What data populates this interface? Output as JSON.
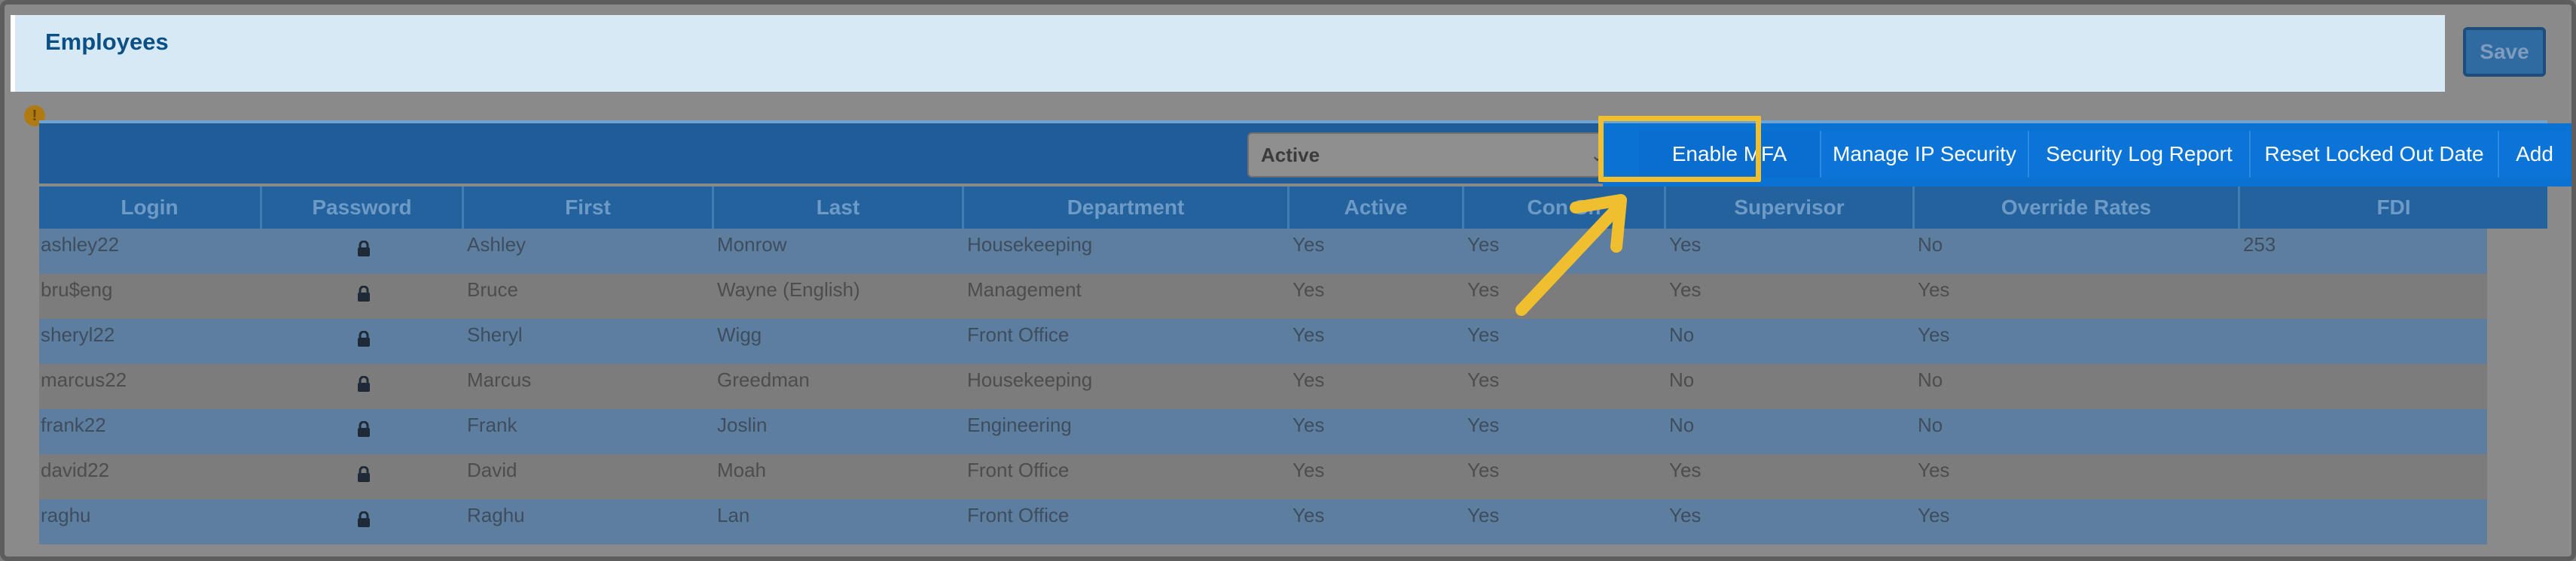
{
  "header": {
    "title": "Employees"
  },
  "actions": {
    "save_label": "Save"
  },
  "toolbar": {
    "status_filter": {
      "selected": "Active"
    },
    "buttons": [
      {
        "label": "Enable MFA"
      },
      {
        "label": "Manage IP Security"
      },
      {
        "label": "Security Log Report"
      },
      {
        "label": "Reset Locked Out Date"
      },
      {
        "label": "Add"
      }
    ]
  },
  "table": {
    "columns": [
      "Login",
      "Password",
      "First",
      "Last",
      "Department",
      "Active",
      "Con Sh",
      "Supervisor",
      "Override Rates",
      "FDI"
    ],
    "rows": [
      {
        "login": "ashley22",
        "first": "Ashley",
        "last": "Monrow",
        "department": "Housekeeping",
        "active": "Yes",
        "con": "Yes",
        "supervisor": "Yes",
        "override": "No",
        "fdi": "253"
      },
      {
        "login": "bru$eng",
        "first": "Bruce",
        "last": "Wayne (English)",
        "department": "Management",
        "active": "Yes",
        "con": "Yes",
        "supervisor": "Yes",
        "override": "Yes",
        "fdi": ""
      },
      {
        "login": "sheryl22",
        "first": "Sheryl",
        "last": "Wigg",
        "department": "Front Office",
        "active": "Yes",
        "con": "Yes",
        "supervisor": "No",
        "override": "Yes",
        "fdi": ""
      },
      {
        "login": "marcus22",
        "first": "Marcus",
        "last": "Greedman",
        "department": "Housekeeping",
        "active": "Yes",
        "con": "Yes",
        "supervisor": "No",
        "override": "No",
        "fdi": ""
      },
      {
        "login": "frank22",
        "first": "Frank",
        "last": "Joslin",
        "department": "Engineering",
        "active": "Yes",
        "con": "Yes",
        "supervisor": "No",
        "override": "No",
        "fdi": ""
      },
      {
        "login": "david22",
        "first": "David",
        "last": "Moah",
        "department": "Front Office",
        "active": "Yes",
        "con": "Yes",
        "supervisor": "Yes",
        "override": "Yes",
        "fdi": ""
      },
      {
        "login": "raghu",
        "first": "Raghu",
        "last": "Lan",
        "department": "Front Office",
        "active": "Yes",
        "con": "Yes",
        "supervisor": "Yes",
        "override": "Yes",
        "fdi": ""
      }
    ]
  },
  "colors": {
    "accent": "#0a72d2",
    "highlight": "#f0bf30",
    "title": "#0b4f87"
  },
  "icons": {
    "warning": "warning-icon",
    "lock": "lock-icon",
    "select": "chevron-down-icon",
    "annotation": "arrow-icon"
  }
}
